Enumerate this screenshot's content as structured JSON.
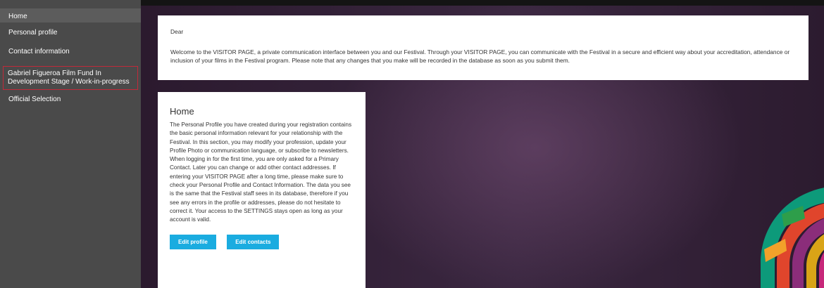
{
  "sidebar": {
    "items": [
      {
        "label": "Home"
      },
      {
        "label": "Personal profile"
      },
      {
        "label": "Contact information"
      },
      {
        "label": "Gabriel Figueroa Film Fund In Development Stage / Work-in-progress"
      },
      {
        "label": "Official Selection"
      }
    ]
  },
  "welcome": {
    "greeting": "Dear",
    "text": "Welcome to the VISITOR PAGE, a private communication interface between you and our Festival. Through your VISITOR PAGE, you can communicate with the Festival in a secure and efficient way about your accreditation, attendance or inclusion of your films in the Festival program. Please note that any changes that you make will be recorded in the database as soon as you submit them."
  },
  "card": {
    "title": "Home",
    "body": "The Personal Profile you have created during your registration contains the basic personal information relevant for your relationship with the Festival. In this section, you may modify your profession, update your Profile Photo or communication language, or subscribe to newsletters. When logging in for the first time, you are only asked for a Primary Contact. Later you can change or add other contact addresses. If entering your VISITOR PAGE after a long time, please make sure to check your Personal Profile and Contact Information. The data you see is the same that the Festival staff sees in its database, therefore if you see any errors in the profile or addresses, please do not hesitate to correct it. Your access to the SETTINGS stays open as long as your account is valid.",
    "edit_profile_label": "Edit profile",
    "edit_contacts_label": "Edit contacts"
  },
  "colors": {
    "sidebar_bg": "#4a4a4a",
    "button_bg": "#1aace0",
    "highlight_border": "#c12a3a"
  }
}
